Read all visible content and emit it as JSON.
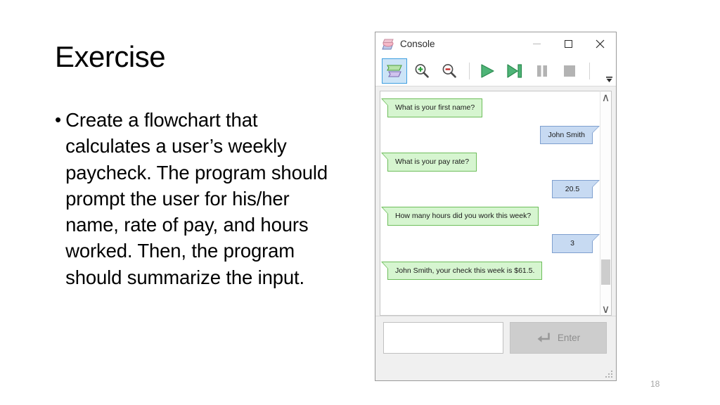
{
  "slide": {
    "title": "Exercise",
    "bullet_marker": "•",
    "bullet_text": "Create a flowchart that calculates a user’s weekly paycheck. The program should prompt the user for his/her name, rate of pay, and hours worked. Then, the program should summarize the input.",
    "slide_number": "18"
  },
  "console": {
    "titlebar": {
      "title": "Console",
      "app_icon": "flowchart-shapes-icon",
      "minimize_label": "—",
      "maximize_label": "□",
      "close_label": "✕"
    },
    "toolbar": {
      "buttons": [
        {
          "name": "shapes-view-icon",
          "label": "",
          "selected": true,
          "enabled": true
        },
        {
          "name": "zoom-in-icon",
          "label": "",
          "selected": false,
          "enabled": true
        },
        {
          "name": "zoom-out-icon",
          "label": "",
          "selected": false,
          "enabled": true
        },
        {
          "name": "play-icon",
          "label": "",
          "selected": false,
          "enabled": true
        },
        {
          "name": "step-icon",
          "label": "",
          "selected": false,
          "enabled": true
        },
        {
          "name": "pause-icon",
          "label": "",
          "selected": false,
          "enabled": false
        },
        {
          "name": "stop-icon",
          "label": "",
          "selected": false,
          "enabled": false
        }
      ],
      "overflow_label": "»"
    },
    "chat": {
      "messages": [
        {
          "side": "left",
          "style": "green",
          "text": "What is your first name?"
        },
        {
          "side": "right",
          "style": "blue",
          "text": "John Smith"
        },
        {
          "side": "left",
          "style": "green",
          "text": "What is your pay rate?"
        },
        {
          "side": "right",
          "style": "blue",
          "text": "20.5"
        },
        {
          "side": "left",
          "style": "green",
          "text": "How many hours did you work this week?"
        },
        {
          "side": "right",
          "style": "blue",
          "text": "3"
        },
        {
          "side": "left",
          "style": "green",
          "text": "John Smith, your check this week is $61.5."
        }
      ],
      "scrollbar": {
        "up_arrow": "∧",
        "down_arrow": "∨"
      }
    },
    "input": {
      "value": "",
      "placeholder": ""
    },
    "enter_button": {
      "label": "Enter",
      "icon": "enter-return-icon",
      "enabled": false
    }
  },
  "colors": {
    "bubble_green_fill": "#d6f5d0",
    "bubble_green_border": "#6dbd5a",
    "bubble_blue_fill": "#c7daf2",
    "bubble_blue_border": "#7e9fcf",
    "toolbar_selected": "#cce4f7",
    "play_green": "#36a85c",
    "disabled_gray": "#b3b3b3"
  }
}
